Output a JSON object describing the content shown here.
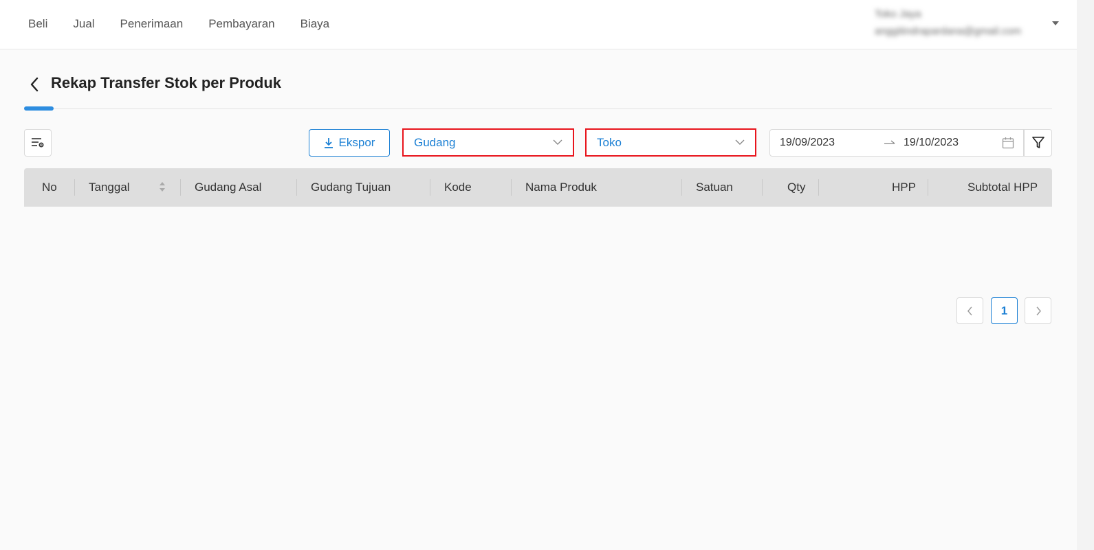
{
  "nav": {
    "items": [
      {
        "label": "Beli"
      },
      {
        "label": "Jual"
      },
      {
        "label": "Penerimaan"
      },
      {
        "label": "Pembayaran"
      },
      {
        "label": "Biaya"
      }
    ]
  },
  "user": {
    "name": "Toko Jaya",
    "email": "anggitindrapardana@gmail.com"
  },
  "page": {
    "title": "Rekap Transfer Stok per Produk",
    "back_icon": "chevron-left-icon"
  },
  "toolbar": {
    "export_label": "Ekspor",
    "source_warehouse": "Gudang",
    "destination_warehouse": "Toko",
    "date_start": "19/09/2023",
    "date_end": "19/10/2023"
  },
  "table": {
    "columns": [
      {
        "label": "No"
      },
      {
        "label": "Tanggal"
      },
      {
        "label": "Gudang Asal"
      },
      {
        "label": "Gudang Tujuan"
      },
      {
        "label": "Kode"
      },
      {
        "label": "Nama Produk"
      },
      {
        "label": "Satuan"
      },
      {
        "label": "Qty"
      },
      {
        "label": "HPP"
      },
      {
        "label": "Subtotal HPP"
      }
    ],
    "rows": []
  },
  "pagination": {
    "current_page": "1"
  },
  "colors": {
    "accent": "#1a7fd4",
    "highlight_border": "#e8141c",
    "header_bg": "#dedede"
  }
}
